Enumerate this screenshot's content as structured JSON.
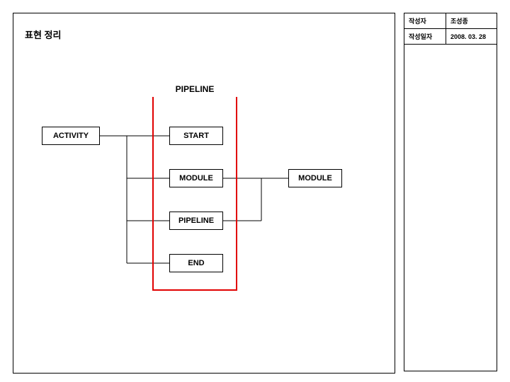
{
  "header": {
    "title": "표현 정리"
  },
  "info": {
    "author_label": "작성자",
    "author_value": "조성종",
    "date_label": "작성일자",
    "date_value": "2008. 03. 28"
  },
  "diagram": {
    "pipeline_label": "PIPELINE",
    "nodes": {
      "activity": "ACTIVITY",
      "start": "START",
      "module1": "MODULE",
      "pipeline_inner": "PIPELINE",
      "end": "END",
      "module2": "MODULE"
    }
  }
}
